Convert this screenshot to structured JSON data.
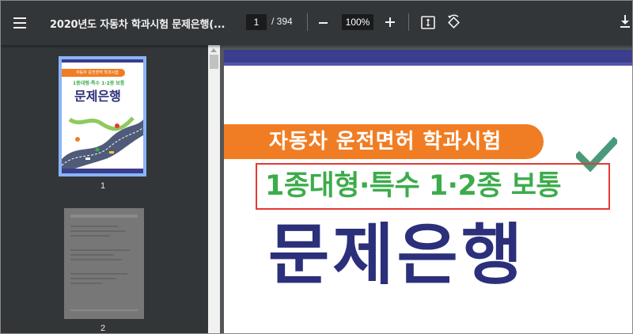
{
  "toolbar": {
    "title": "2020년도 자동차 학과시험 문제은행(...",
    "page_current": "1",
    "page_total": "/ 394",
    "zoom": "100%",
    "menu_icon": "hamburger-menu-icon",
    "fit_icon": "fit-to-page-icon",
    "rotate_icon": "rotate-icon",
    "download_icon": "download-icon"
  },
  "sidebar": {
    "thumbnails": [
      {
        "page_label": "1",
        "pill_text": "자동차 운전면허 학과시험",
        "subtitle": "1종대형·특수 1·2종 보통",
        "title": "문제은행"
      },
      {
        "page_label": "2"
      }
    ]
  },
  "document": {
    "banner_text": "자동차 운전면허 학과시험",
    "subtitle": "1종대형·특수 1·2종 보통",
    "title": "문제은행",
    "colors": {
      "banner": "#f07d24",
      "subtitle": "#3cac4b",
      "title": "#2c2f7a",
      "highlight_box": "#e53935",
      "checkmark": "#4a9a7a"
    }
  }
}
